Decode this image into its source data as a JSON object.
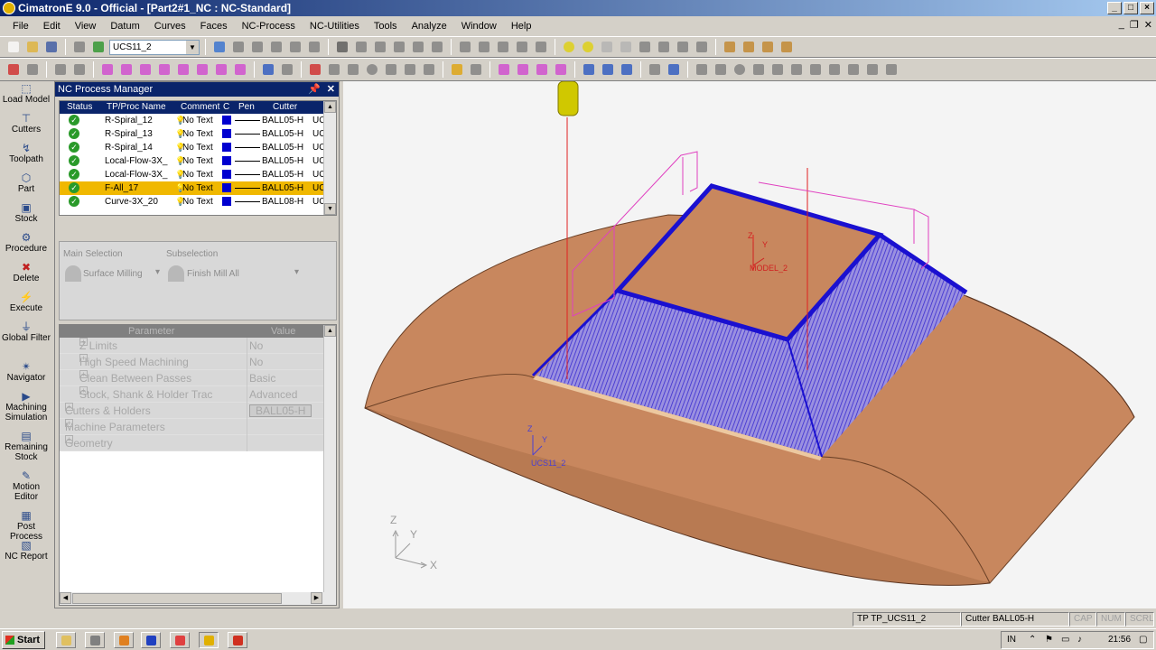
{
  "window": {
    "title": "CimatronE 9.0 - Official - [Part2#1_NC : NC-Standard]",
    "controls": [
      "_",
      "□",
      "×"
    ]
  },
  "menu": [
    "File",
    "Edit",
    "View",
    "Datum",
    "Curves",
    "Faces",
    "NC-Process",
    "NC-Utilities",
    "Tools",
    "Analyze",
    "Window",
    "Help"
  ],
  "toolbar": {
    "ucs_select": "UCS11_2"
  },
  "leftbar": [
    {
      "label": "Load Model",
      "icon": "load-model-icon"
    },
    {
      "label": "Cutters",
      "icon": "cutters-icon"
    },
    {
      "label": "Toolpath",
      "icon": "toolpath-icon"
    },
    {
      "label": "Part",
      "icon": "part-icon"
    },
    {
      "label": "Stock",
      "icon": "stock-icon"
    },
    {
      "label": "Procedure",
      "icon": "procedure-icon"
    },
    {
      "label": "Delete",
      "icon": "delete-icon"
    },
    {
      "label": "Execute",
      "icon": "execute-icon"
    },
    {
      "label": "Global Filter",
      "icon": "filter-icon"
    },
    {
      "label": "Navigator",
      "icon": "navigator-icon"
    },
    {
      "label": "Machining Simulation",
      "icon": "simulation-icon"
    },
    {
      "label": "Remaining Stock",
      "icon": "remaining-stock-icon"
    },
    {
      "label": "Motion Editor",
      "icon": "motion-editor-icon"
    },
    {
      "label": "Post Process",
      "icon": "post-process-icon"
    },
    {
      "label": "NC Report",
      "icon": "nc-report-icon"
    }
  ],
  "nc_manager": {
    "title": "NC Process Manager",
    "columns": [
      "Status",
      "TP/Proc Name",
      "Comment",
      "C",
      "Pen",
      "Cutter",
      ""
    ],
    "rows": [
      {
        "name": "R-Spiral_12",
        "comment": "No Text",
        "cutter": "BALL05-H",
        "ucs": "UC"
      },
      {
        "name": "R-Spiral_13",
        "comment": "No Text",
        "cutter": "BALL05-H",
        "ucs": "UC"
      },
      {
        "name": "R-Spiral_14",
        "comment": "No Text",
        "cutter": "BALL05-H",
        "ucs": "UC"
      },
      {
        "name": "Local-Flow-3X_",
        "comment": "No Text",
        "cutter": "BALL05-H",
        "ucs": "UC"
      },
      {
        "name": "Local-Flow-3X_",
        "comment": "No Text",
        "cutter": "BALL05-H",
        "ucs": "UC"
      },
      {
        "name": "F-All_17",
        "comment": "No Text",
        "cutter": "BALL05-H",
        "ucs": "UC",
        "selected": true
      },
      {
        "name": "Curve-3X_20",
        "comment": "No Text",
        "cutter": "BALL08-H",
        "ucs": "UC"
      }
    ],
    "main_selection_label": "Main Selection",
    "main_selection_value": "Surface Milling",
    "subselection_label": "Subselection",
    "subselection_value": "Finish Mill All",
    "param_header": "Parameter",
    "value_header": "Value",
    "params": [
      {
        "name": "Z Limits",
        "value": "No",
        "indent": 2
      },
      {
        "name": "High Speed Machining",
        "value": "No",
        "indent": 2
      },
      {
        "name": "Clean Between Passes",
        "value": "Basic",
        "indent": 2
      },
      {
        "name": "Stock, Shank & Holder Trac",
        "value": "Advanced",
        "indent": 2
      },
      {
        "name": "Cutters & Holders",
        "value": "BALL05-H",
        "indent": 1
      },
      {
        "name": "Machine Parameters",
        "value": "",
        "indent": 1
      },
      {
        "name": "Geometry",
        "value": "",
        "indent": 1
      }
    ]
  },
  "viewport": {
    "model_label": "MODEL_2",
    "ucs_label": "UCS11_2",
    "triad": {
      "x": "X",
      "y": "Y",
      "z": "Z"
    }
  },
  "statusbar": {
    "tp": "TP  TP_UCS11_2",
    "cutter": "Cutter  BALL05-H",
    "cap": "CAP",
    "num": "NUM",
    "scrl": "SCRL"
  },
  "taskbar": {
    "start": "Start",
    "lang": "IN",
    "time": "21:56"
  }
}
